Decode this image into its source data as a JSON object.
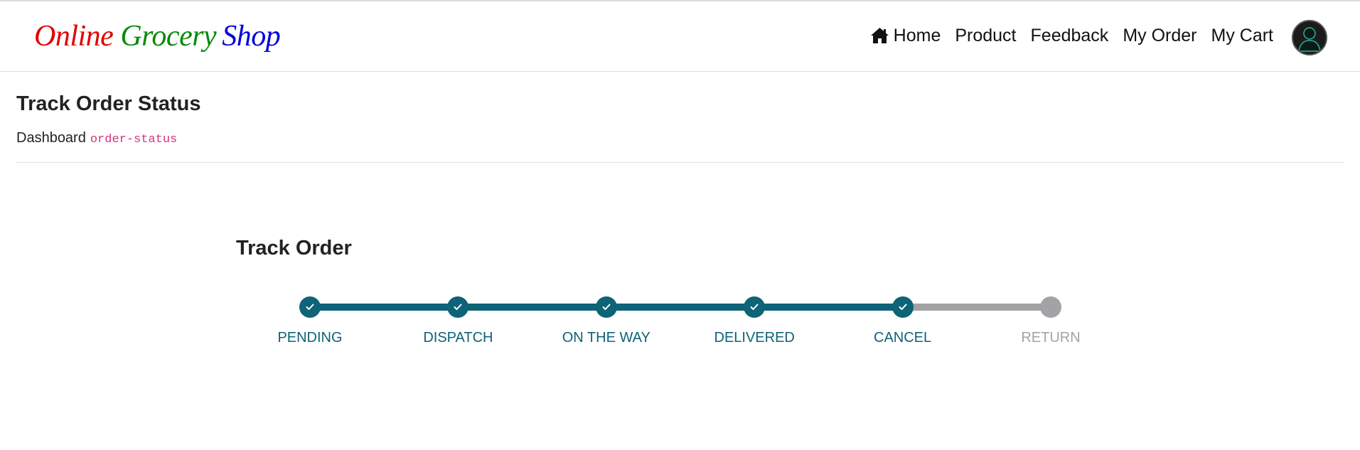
{
  "brand": {
    "words": [
      {
        "text": "Online",
        "color": "#e00000"
      },
      {
        "text": "Grocery",
        "color": "#0a8a0a"
      },
      {
        "text": "Shop",
        "color": "#0000dd"
      }
    ]
  },
  "nav": {
    "home": "Home",
    "product": "Product",
    "feedback": "Feedback",
    "my_order": "My Order",
    "my_cart": "My Cart"
  },
  "header": {
    "title": "Track Order Status",
    "breadcrumb_root": "Dashboard",
    "breadcrumb_current": "order-status"
  },
  "tracker": {
    "title": "Track Order",
    "active_color": "#0e6377",
    "inactive_color": "#a3a3a6",
    "steps": [
      {
        "label": "PENDING",
        "done": true
      },
      {
        "label": "DISPATCH",
        "done": true
      },
      {
        "label": "ON THE WAY",
        "done": true
      },
      {
        "label": "DELIVERED",
        "done": true
      },
      {
        "label": "CANCEL",
        "done": true
      },
      {
        "label": "RETURN",
        "done": false
      }
    ]
  }
}
